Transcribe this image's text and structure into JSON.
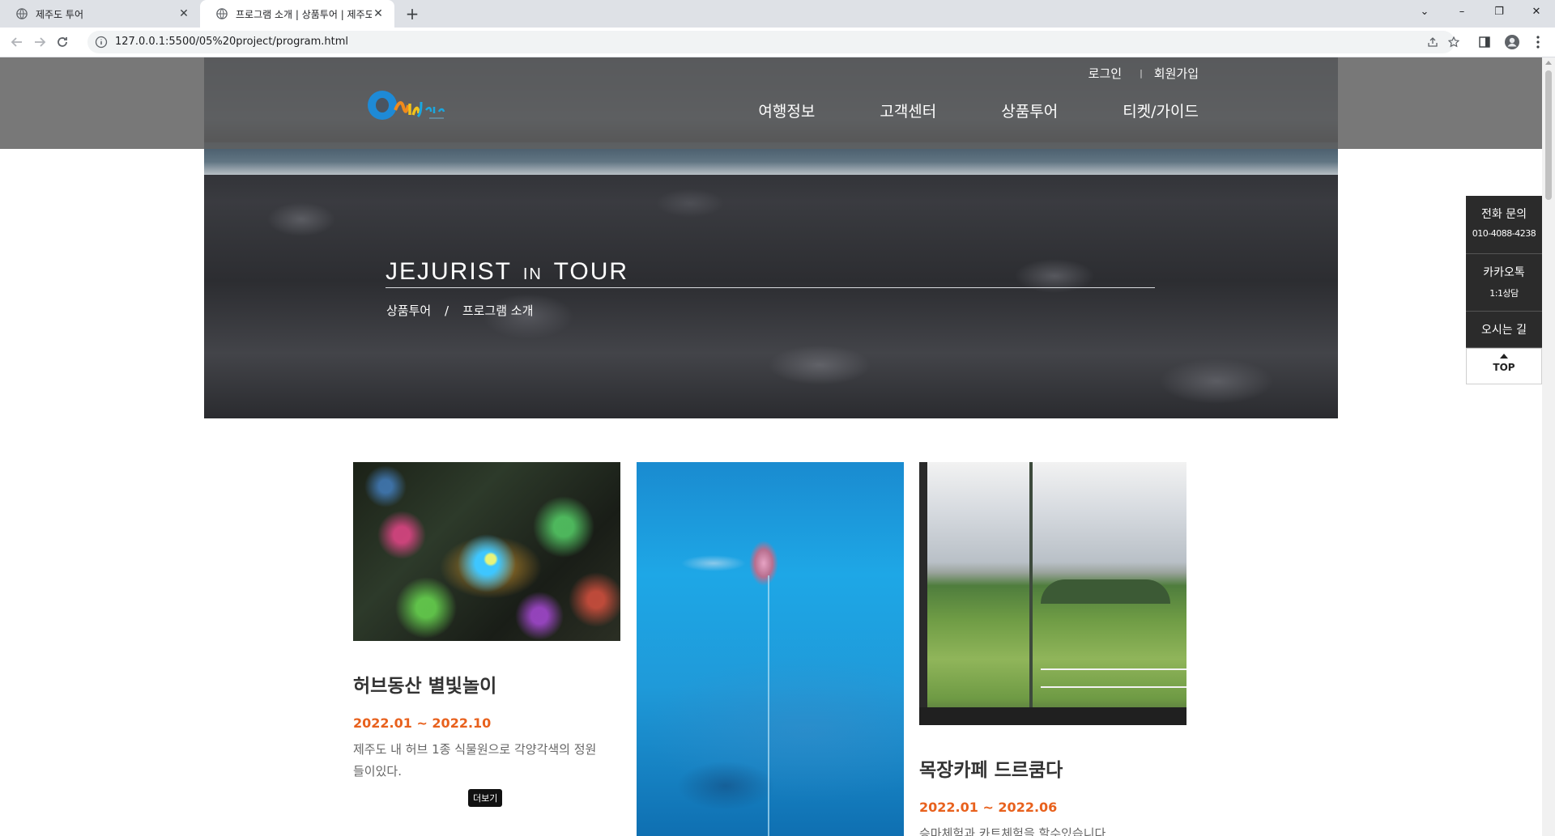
{
  "browser": {
    "tabs": [
      {
        "title": "제주도 투어",
        "active": false
      },
      {
        "title": "프로그램 소개 | 상품투어 | 제주도 투어",
        "active": true
      }
    ],
    "url": "127.0.0.1:5500/05%20project/program.html"
  },
  "header": {
    "logo_text": "Only Jeju",
    "login": "로그인",
    "divider": "|",
    "signup": "회원가입",
    "nav": [
      "여행정보",
      "고객센터",
      "상품투어",
      "티켓/가이드"
    ]
  },
  "hero": {
    "title_part1": "JEJURIST",
    "title_in": "IN",
    "title_part2": "TOUR",
    "breadcrumb": [
      "상품투어",
      "프로그램 소개"
    ],
    "breadcrumb_sep": "/"
  },
  "quick_menu": {
    "phone_label": "전화 문의",
    "phone_number": "010-4088-4238",
    "kakao_label": "카카오톡",
    "kakao_sub": "1:1상담",
    "directions": "오시는 길",
    "top": "TOP"
  },
  "programs": [
    {
      "title": "허브동산 별빛놀이",
      "period": "2022.01 ~ 2022.10",
      "description": "제주도 내 허브 1종 식물원으로 각양각색의 정원들이있다.",
      "more": "더보기"
    },
    {
      "title": "",
      "period": "",
      "description": ""
    },
    {
      "title": "목장카페 드르쿰다",
      "period": "2022.01 ~ 2022.06",
      "description": "승마체험과 카트체험을 할수있습니다."
    }
  ],
  "colors": {
    "accent_date": "#e8611d",
    "quick_bg": "#2b2b2b",
    "header_overlay": "#606060"
  }
}
